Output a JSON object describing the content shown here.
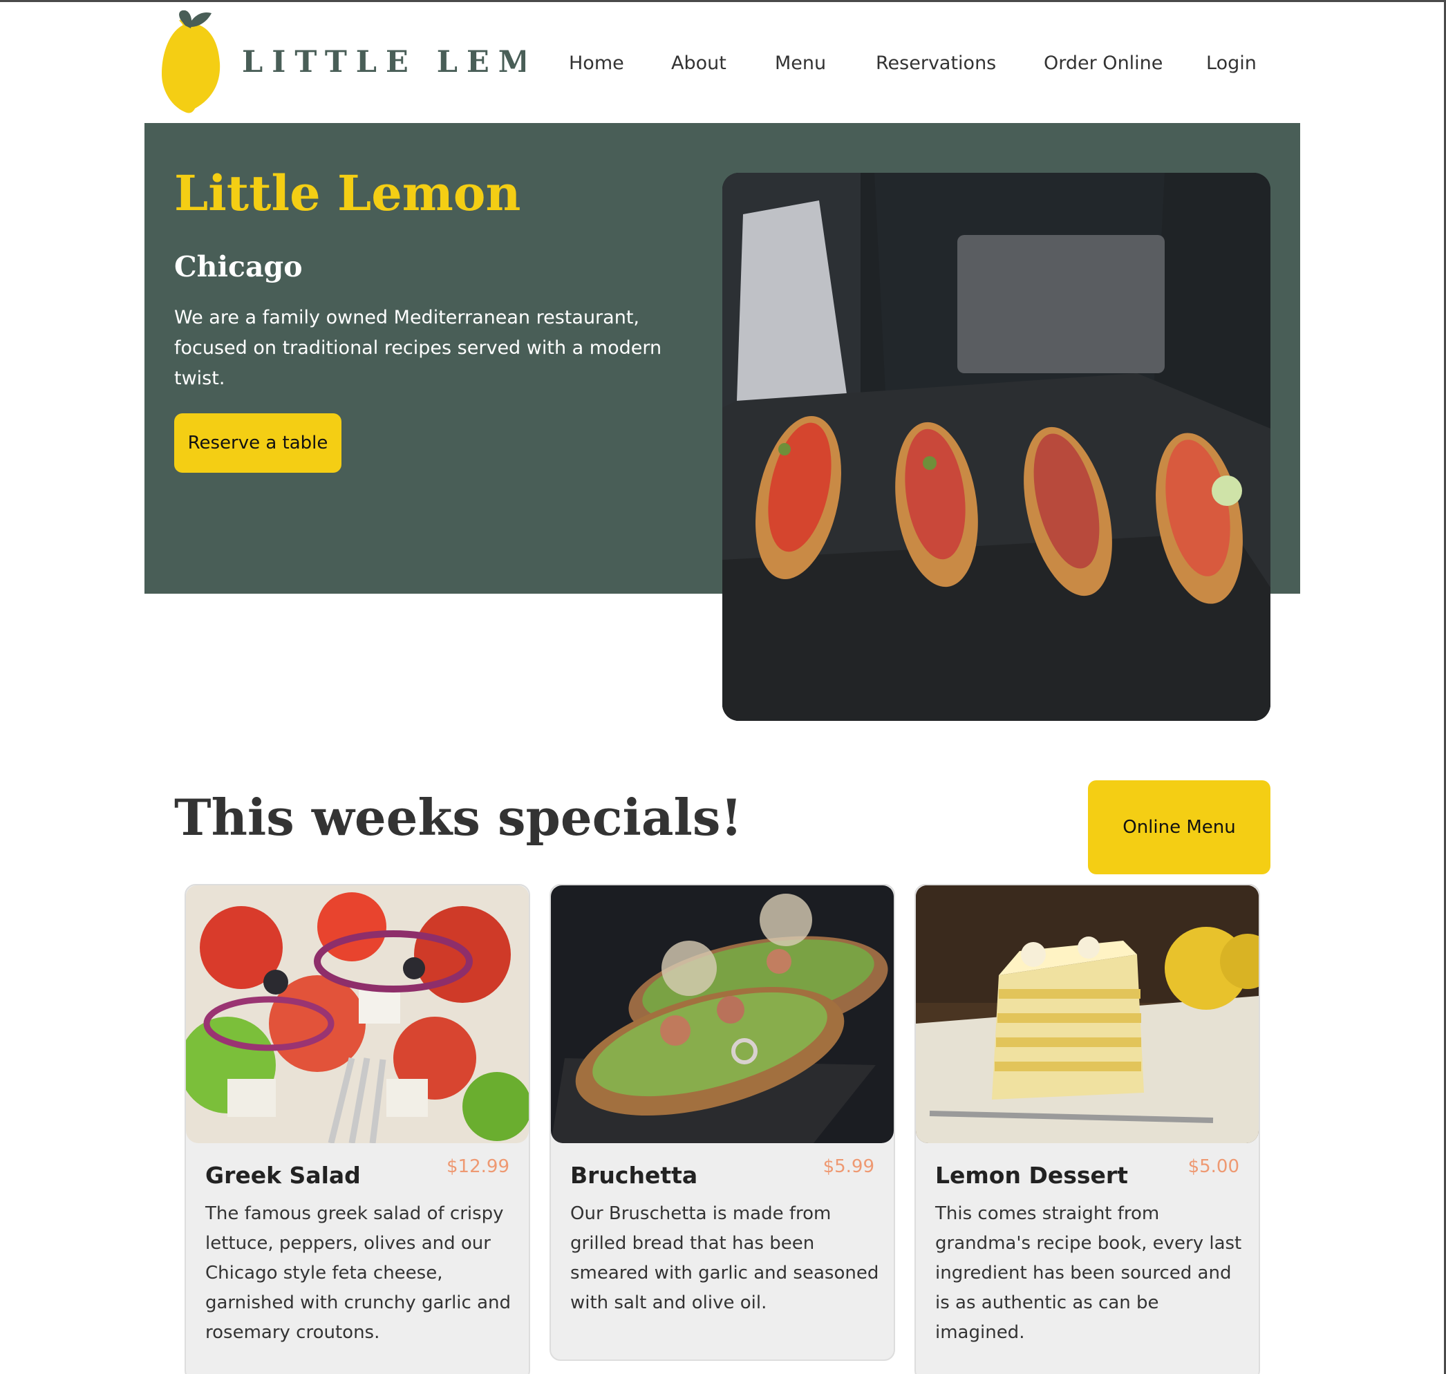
{
  "brand": {
    "name": "LITTLE LEMON",
    "lemon_color": "#f4ce14",
    "green_color": "#495e57"
  },
  "nav": {
    "items": [
      {
        "label": "Home"
      },
      {
        "label": "About"
      },
      {
        "label": "Menu"
      },
      {
        "label": "Reservations"
      },
      {
        "label": "Order Online"
      },
      {
        "label": "Login"
      }
    ]
  },
  "hero": {
    "title": "Little Lemon",
    "subtitle": "Chicago",
    "description": "We are a family owned Mediterranean restaurant, focused on traditional recipes served with a modern twist.",
    "button_label": "Reserve a table",
    "image_icon": "bruschetta-tray-photo"
  },
  "specials": {
    "title": "This weeks specials!",
    "button_label": "Online Menu",
    "cards": [
      {
        "name": "Greek Salad",
        "price": "$12.99",
        "description": "The famous greek salad of crispy lettuce, peppers, olives and our Chicago style feta cheese, garnished with crunchy garlic and rosemary croutons.",
        "image_icon": "greek-salad-photo"
      },
      {
        "name": "Bruchetta",
        "price": "$5.99",
        "description": "Our Bruschetta is made from grilled bread that has been smeared with garlic and seasoned with salt and olive oil.",
        "image_icon": "bruschetta-photo"
      },
      {
        "name": "Lemon Dessert",
        "price": "$5.00",
        "description": "This comes straight from grandma's recipe book, every last ingredient has been sourced and is as authentic as can be imagined.",
        "image_icon": "lemon-dessert-photo"
      }
    ]
  },
  "colors": {
    "accent_yellow": "#f4ce14",
    "hero_green": "#495e57",
    "price_orange": "#ee9972",
    "card_bg": "#eeeeee"
  }
}
